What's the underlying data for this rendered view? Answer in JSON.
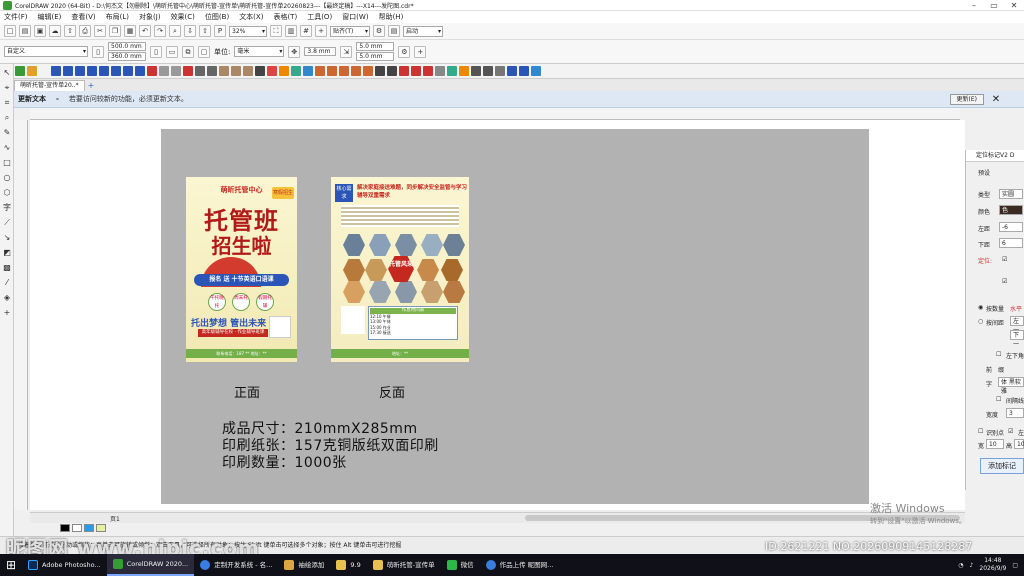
{
  "window": {
    "title": "CorelDRAW 2020 (64-Bit) - D:\\何杰文【勿删除】\\萌昕托管中心\\萌昕托管-宣传单\\萌昕托管-宣传单20260823---【最终定稿】---X14---发陀图.cdr*"
  },
  "menu": [
    "文件(F)",
    "编辑(E)",
    "查看(V)",
    "布局(L)",
    "对象(J)",
    "效果(C)",
    "位图(B)",
    "文本(X)",
    "表格(T)",
    "工具(O)",
    "窗口(W)",
    "帮助(H)"
  ],
  "toolbar1": {
    "zoom": "32%",
    "snap": "贴齐(T)",
    "launch": "启动"
  },
  "toolbar2": {
    "preset": "自定义",
    "width": "500.0 mm",
    "height": "360.0 mm",
    "units_label": "单位:",
    "units": "毫米",
    "nudge": "3.8 mm",
    "dup_x": "5.0 mm",
    "dup_y": "5.0 mm"
  },
  "tab": {
    "label": "萌昕托管-宣传单20..*"
  },
  "hint": {
    "label": "更新文本",
    "desc": "若要访问较新的功能，必须更新文本。",
    "button": "更新(E)"
  },
  "front": {
    "logo": "萌昕托管中心",
    "badge": "寒假招生",
    "title1": "托管班",
    "title2": "招生啦",
    "pill": "报名 送 十节英语口语课",
    "circles": [
      "午托晚托",
      "周末托",
      "假期托辅"
    ],
    "slogan": "托出梦想 管出未来",
    "bar": "高年级辅导在校 · 作业辅导班课",
    "footer": "联系电话：187 ** 地址：**"
  },
  "back": {
    "tag": "核心需求",
    "head": "解决家庭接送难题，同步解决安全监管与学习辅导双重需求",
    "center": "托管风采",
    "table_head": "作息时间表",
    "rows": [
      "12:10 午餐",
      "13:00 午休",
      "15:00 作业",
      "17:30 接送"
    ],
    "footer": "地址：**"
  },
  "captions": {
    "front": "正面",
    "back": "反面"
  },
  "specs": [
    "成品尺寸：210mmX285mm",
    "印刷纸张：157克铜版纸双面印刷",
    "印刷数量：1000张"
  ],
  "rpanel": {
    "title": "定位标记V2 D",
    "preset": "预设",
    "type_label": "类型",
    "type_val": "实圆",
    "color_label": "颜色",
    "color_val": "色",
    "left_label": "左距",
    "left_val": "-6",
    "bottom_label": "下距",
    "bottom_val": "6",
    "pos_label": "定位:",
    "count_label": "按数量",
    "count_val": "水平",
    "spacing_label": "按间距",
    "spacing_val": "左一",
    "down": "下一",
    "left_bottom": "左下角",
    "front_label": "前",
    "front_val": "缀",
    "font_label": "字",
    "font_val": "体 黑软雅",
    "check1": "间隔线",
    "width_label": "宽度",
    "width_val": "3",
    "marks": "识别点",
    "tail": "左",
    "w_label": "宽",
    "w_val": "10",
    "h_label": "高",
    "h_val": "10",
    "add_button": "添加标记"
  },
  "scroll": {
    "page": "页1"
  },
  "status": {
    "text": "接着单击可进行拖动或缩放；再单击可旋转或倾斜；双击工具，可选择所有对象；按住 Shift 键单击可选择多个对象；按住 Alt 键单击可进行挖掘"
  },
  "watermark": "昵图网 www.nipic.com",
  "idwm": "ID:2621221 NO:20260909145128287",
  "activate": {
    "line1": "激活 Windows",
    "line2": "转到\"设置\"以激活 Windows。"
  },
  "taskbar": {
    "items": [
      "Adobe Photosho...",
      "CorelDRAW 2020...",
      "定制开发系统 - 名...",
      "袖绘添加",
      "9.9",
      "萌昕托管-宣传单",
      "微信",
      "作品上传 昵图网..."
    ],
    "time": "14:48",
    "date": "2026/9/9"
  },
  "colors": {
    "accent": "#2b56b8",
    "brand_red": "#c4281e",
    "page_gray": "#b2b2b2",
    "green": "#74b04a"
  }
}
